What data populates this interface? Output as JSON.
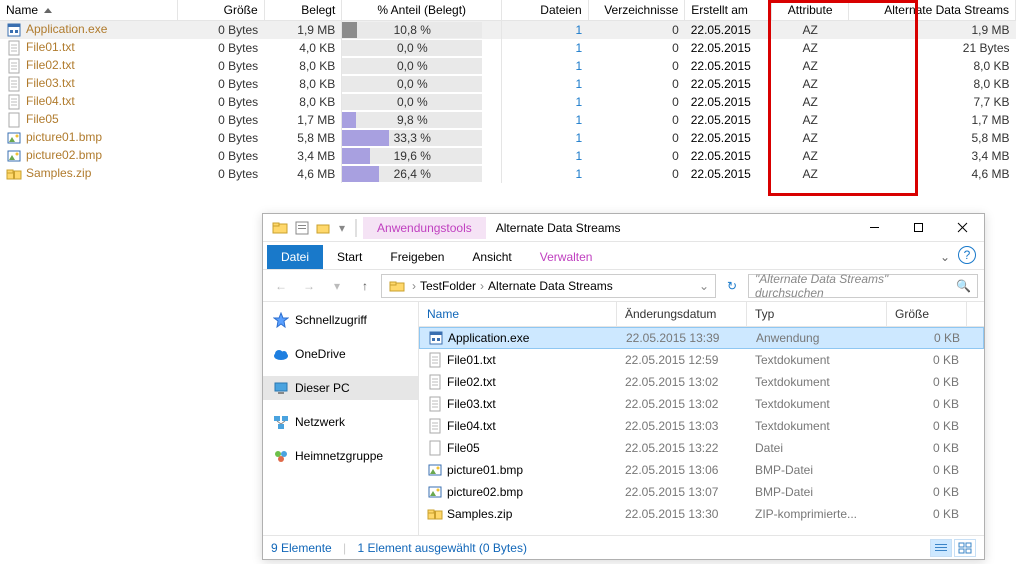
{
  "top_table": {
    "headers": {
      "name": "Name",
      "size": "Größe",
      "allocated": "Belegt",
      "pct": "% Anteil (Belegt)",
      "files": "Dateien",
      "dirs": "Verzeichnisse",
      "created": "Erstellt am",
      "attr": "Attribute",
      "ads": "Alternate Data Streams"
    },
    "rows": [
      {
        "icon": "exe",
        "name": "Application.exe",
        "size": "0 Bytes",
        "alloc": "1,9 MB",
        "pct": "10,8 %",
        "pctv": 10.8,
        "files": "1",
        "dirs": "0",
        "created": "22.05.2015",
        "attr": "AZ",
        "ads": "1,9 MB",
        "sel": true
      },
      {
        "icon": "txt",
        "name": "File01.txt",
        "size": "0 Bytes",
        "alloc": "4,0 KB",
        "pct": "0,0 %",
        "pctv": 0,
        "files": "1",
        "dirs": "0",
        "created": "22.05.2015",
        "attr": "AZ",
        "ads": "21 Bytes"
      },
      {
        "icon": "txt",
        "name": "File02.txt",
        "size": "0 Bytes",
        "alloc": "8,0 KB",
        "pct": "0,0 %",
        "pctv": 0,
        "files": "1",
        "dirs": "0",
        "created": "22.05.2015",
        "attr": "AZ",
        "ads": "8,0 KB"
      },
      {
        "icon": "txt",
        "name": "File03.txt",
        "size": "0 Bytes",
        "alloc": "8,0 KB",
        "pct": "0,0 %",
        "pctv": 0,
        "files": "1",
        "dirs": "0",
        "created": "22.05.2015",
        "attr": "AZ",
        "ads": "8,0 KB"
      },
      {
        "icon": "txt",
        "name": "File04.txt",
        "size": "0 Bytes",
        "alloc": "8,0 KB",
        "pct": "0,0 %",
        "pctv": 0,
        "files": "1",
        "dirs": "0",
        "created": "22.05.2015",
        "attr": "AZ",
        "ads": "7,7 KB"
      },
      {
        "icon": "blank",
        "name": "File05",
        "size": "0 Bytes",
        "alloc": "1,7 MB",
        "pct": "9,8 %",
        "pctv": 9.8,
        "files": "1",
        "dirs": "0",
        "created": "22.05.2015",
        "attr": "AZ",
        "ads": "1,7 MB"
      },
      {
        "icon": "bmp",
        "name": "picture01.bmp",
        "size": "0 Bytes",
        "alloc": "5,8 MB",
        "pct": "33,3 %",
        "pctv": 33.3,
        "files": "1",
        "dirs": "0",
        "created": "22.05.2015",
        "attr": "AZ",
        "ads": "5,8 MB"
      },
      {
        "icon": "bmp",
        "name": "picture02.bmp",
        "size": "0 Bytes",
        "alloc": "3,4 MB",
        "pct": "19,6 %",
        "pctv": 19.6,
        "files": "1",
        "dirs": "0",
        "created": "22.05.2015",
        "attr": "AZ",
        "ads": "3,4 MB"
      },
      {
        "icon": "zip",
        "name": "Samples.zip",
        "size": "0 Bytes",
        "alloc": "4,6 MB",
        "pct": "26,4 %",
        "pctv": 26.4,
        "files": "1",
        "dirs": "0",
        "created": "22.05.2015",
        "attr": "AZ",
        "ads": "4,6 MB"
      }
    ]
  },
  "explorer": {
    "tool_tab": "Anwendungstools",
    "title": "Alternate Data Streams",
    "ribbon": {
      "file": "Datei",
      "start": "Start",
      "share": "Freigeben",
      "view": "Ansicht",
      "manage": "Verwalten"
    },
    "breadcrumb": {
      "a": "TestFolder",
      "b": "Alternate Data Streams"
    },
    "search_placeholder": "\"Alternate Data Streams\" durchsuchen",
    "sidebar": {
      "quick": "Schnellzugriff",
      "onedrive": "OneDrive",
      "thispc": "Dieser PC",
      "network": "Netzwerk",
      "homegroup": "Heimnetzgruppe"
    },
    "headers": {
      "name": "Name",
      "date": "Änderungsdatum",
      "type": "Typ",
      "size": "Größe"
    },
    "rows": [
      {
        "icon": "exe",
        "name": "Application.exe",
        "date": "22.05.2015 13:39",
        "type": "Anwendung",
        "size": "0 KB",
        "sel": true
      },
      {
        "icon": "txt",
        "name": "File01.txt",
        "date": "22.05.2015 12:59",
        "type": "Textdokument",
        "size": "0 KB"
      },
      {
        "icon": "txt",
        "name": "File02.txt",
        "date": "22.05.2015 13:02",
        "type": "Textdokument",
        "size": "0 KB"
      },
      {
        "icon": "txt",
        "name": "File03.txt",
        "date": "22.05.2015 13:02",
        "type": "Textdokument",
        "size": "0 KB"
      },
      {
        "icon": "txt",
        "name": "File04.txt",
        "date": "22.05.2015 13:03",
        "type": "Textdokument",
        "size": "0 KB"
      },
      {
        "icon": "blank",
        "name": "File05",
        "date": "22.05.2015 13:22",
        "type": "Datei",
        "size": "0 KB"
      },
      {
        "icon": "bmp",
        "name": "picture01.bmp",
        "date": "22.05.2015 13:06",
        "type": "BMP-Datei",
        "size": "0 KB"
      },
      {
        "icon": "bmp",
        "name": "picture02.bmp",
        "date": "22.05.2015 13:07",
        "type": "BMP-Datei",
        "size": "0 KB"
      },
      {
        "icon": "zip",
        "name": "Samples.zip",
        "date": "22.05.2015 13:30",
        "type": "ZIP-komprimierte...",
        "size": "0 KB"
      }
    ],
    "status": {
      "count": "9 Elemente",
      "sel": "1 Element ausgewählt (0 Bytes)"
    }
  }
}
